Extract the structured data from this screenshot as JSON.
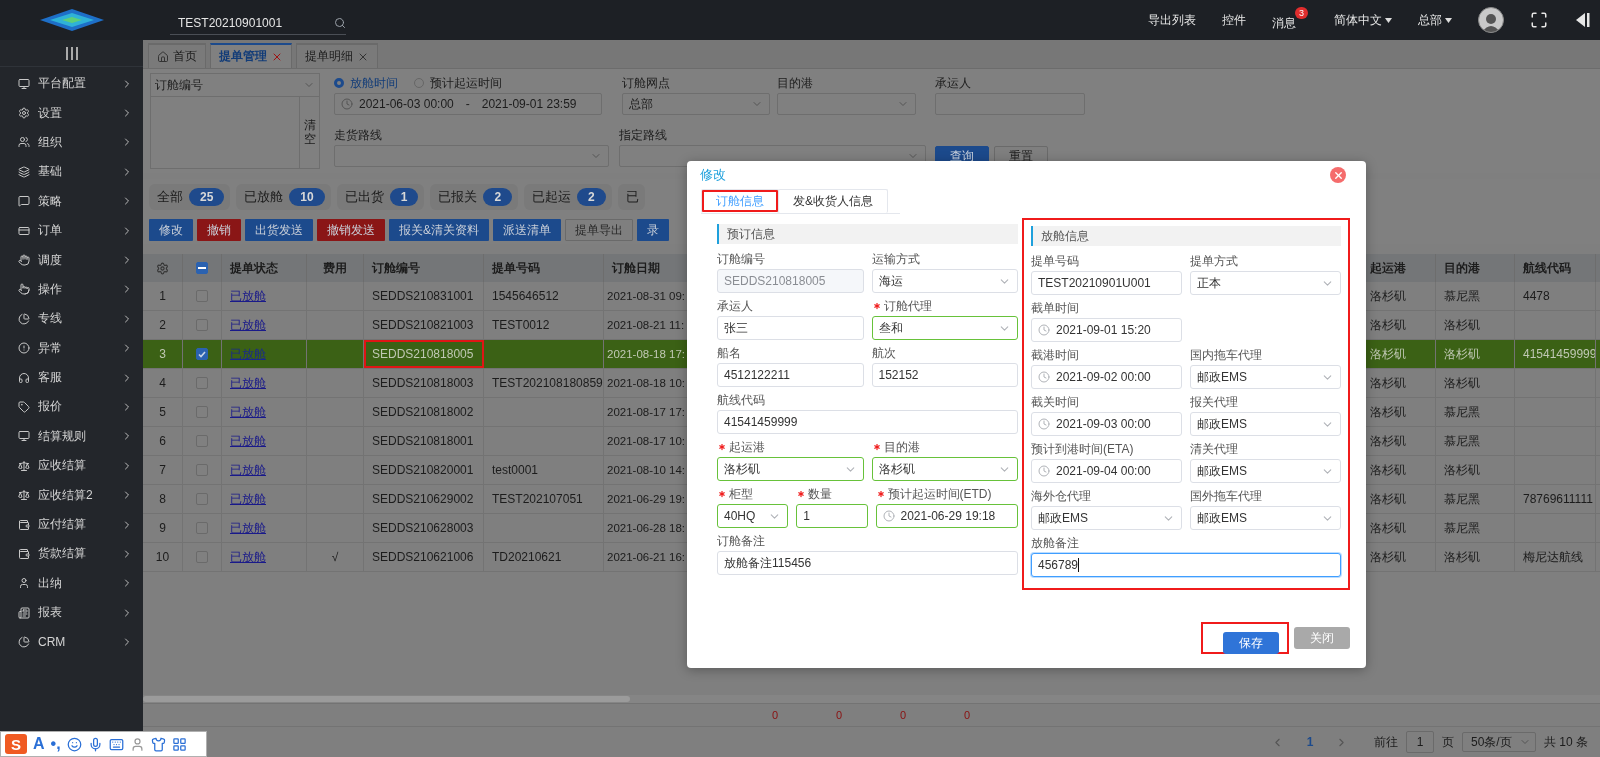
{
  "topbar": {
    "search": {
      "value": "TEST20210901001"
    },
    "links": [
      {
        "label": "导出列表",
        "dropdown": false
      },
      {
        "label": "控件",
        "dropdown": false
      },
      {
        "label": "消息",
        "dropdown": false,
        "badge": "3"
      },
      {
        "label": "简体中文",
        "dropdown": true
      },
      {
        "label": "总部",
        "dropdown": true
      }
    ]
  },
  "sidebar": {
    "items": [
      {
        "label": "平台配置"
      },
      {
        "label": "设置"
      },
      {
        "label": "组织"
      },
      {
        "label": "基础"
      },
      {
        "label": "策略"
      },
      {
        "label": "订单"
      },
      {
        "label": "调度"
      },
      {
        "label": "操作"
      },
      {
        "label": "专线"
      },
      {
        "label": "异常"
      },
      {
        "label": "客服"
      },
      {
        "label": "报价"
      },
      {
        "label": "结算规则"
      },
      {
        "label": "应收结算"
      },
      {
        "label": "应收结算2"
      },
      {
        "label": "应付结算"
      },
      {
        "label": "货款结算"
      },
      {
        "label": "出纳"
      },
      {
        "label": "报表"
      },
      {
        "label": "CRM"
      }
    ]
  },
  "page_tabs": [
    {
      "label": "首页",
      "kind": "home",
      "selected": false
    },
    {
      "label": "提单管理",
      "kind": "page",
      "selected": true
    },
    {
      "label": "提单明细",
      "kind": "page",
      "selected": false
    }
  ],
  "filters": {
    "field_select": "订舱编号",
    "clear_button": "清空",
    "time_options": [
      {
        "label": "放舱时间",
        "selected": true
      },
      {
        "label": "预计起运时间",
        "selected": false
      }
    ],
    "date_range": {
      "start": "2021-06-03 00:00",
      "separator": "-",
      "end": "2021-09-01 23:59"
    },
    "row1": [
      {
        "label": "订舱网点",
        "kind": "select",
        "value": "总部"
      },
      {
        "label": "目的港",
        "kind": "select"
      },
      {
        "label": "承运人",
        "kind": "input"
      }
    ],
    "row2": [
      {
        "label": "走货路线",
        "kind": "select"
      },
      {
        "label": "指定路线",
        "kind": "select"
      }
    ],
    "buttons": [
      {
        "label": "查询",
        "kind": "primary"
      },
      {
        "label": "重置",
        "kind": "default"
      }
    ]
  },
  "status_chips": [
    {
      "label": "全部",
      "count": "25"
    },
    {
      "label": "已放舱",
      "count": "10"
    },
    {
      "label": "已出货",
      "count": "1"
    },
    {
      "label": "已报关",
      "count": "2"
    },
    {
      "label": "已起运",
      "count": "2"
    },
    {
      "label": "已"
    }
  ],
  "actions": [
    {
      "label": "修改",
      "kind": "primary"
    },
    {
      "label": "撤销",
      "kind": "danger"
    },
    {
      "label": "出货发送",
      "kind": "primary"
    },
    {
      "label": "撤销发送",
      "kind": "danger"
    },
    {
      "label": "报关&清关资料",
      "kind": "primary"
    },
    {
      "label": "派送清单",
      "kind": "primary"
    },
    {
      "label": "提单导出",
      "kind": "default"
    },
    {
      "label": "录",
      "kind": "primary"
    }
  ],
  "table": {
    "select_all": {
      "partial": true
    },
    "columns": [
      "提单状态",
      "费用",
      "订舱编号",
      "提单号码",
      "订舱日期",
      "起运港",
      "目的港",
      "航线代码"
    ],
    "rows": [
      {
        "index": "1",
        "checked": false,
        "selected": false,
        "annotated": false,
        "status": "已放舱",
        "order_no": "SEDDS210831001",
        "bill_no": "1545646512",
        "order_date": "2021-08-31 09:",
        "origin": "洛杉矶",
        "destination": "慕尼黑",
        "route_code": "4478"
      },
      {
        "index": "2",
        "checked": false,
        "selected": false,
        "annotated": false,
        "status": "已放舱",
        "order_no": "SEDDS210821003",
        "bill_no": "TEST0012",
        "order_date": "2021-08-21 11:",
        "origin": "洛杉矶",
        "destination": "洛杉矶"
      },
      {
        "index": "3",
        "checked": true,
        "selected": true,
        "annotated": true,
        "status": "已放舱",
        "order_no": "SEDDS210818005",
        "order_date": "2021-08-18 17:",
        "origin": "洛杉矶",
        "destination": "洛杉矶",
        "route_code": "41541459999"
      },
      {
        "index": "4",
        "checked": false,
        "selected": false,
        "annotated": false,
        "status": "已放舱",
        "order_no": "SEDDS210818003",
        "bill_no": "TEST202108180859",
        "order_date": "2021-08-18 10:",
        "origin": "洛杉矶",
        "destination": "洛杉矶"
      },
      {
        "index": "5",
        "checked": false,
        "selected": false,
        "annotated": false,
        "status": "已放舱",
        "order_no": "SEDDS210818002",
        "order_date": "2021-08-17 17:",
        "origin": "洛杉矶",
        "destination": "慕尼黑"
      },
      {
        "index": "6",
        "checked": false,
        "selected": false,
        "annotated": false,
        "status": "已放舱",
        "order_no": "SEDDS210818001",
        "order_date": "2021-08-17 10:",
        "origin": "洛杉矶",
        "destination": "慕尼黑"
      },
      {
        "index": "7",
        "checked": false,
        "selected": false,
        "annotated": false,
        "status": "已放舱",
        "order_no": "SEDDS210820001",
        "bill_no": "test0001",
        "order_date": "2021-08-10 14:",
        "origin": "洛杉矶",
        "destination": "洛杉矶"
      },
      {
        "index": "8",
        "checked": false,
        "selected": false,
        "annotated": false,
        "status": "已放舱",
        "order_no": "SEDDS210629002",
        "bill_no": "TEST202107051",
        "order_date": "2021-06-29 19:",
        "origin": "洛杉矶",
        "destination": "慕尼黑",
        "route_code": "78769611111"
      },
      {
        "index": "9",
        "checked": false,
        "selected": false,
        "annotated": false,
        "status": "已放舱",
        "order_no": "SEDDS210628003",
        "order_date": "2021-06-28 18:",
        "origin": "洛杉矶",
        "destination": "慕尼黑"
      },
      {
        "index": "10",
        "checked": false,
        "selected": false,
        "annotated": false,
        "status": "已放舱",
        "fee": "√",
        "order_no": "SEDDS210621006",
        "bill_no": "TD20210621",
        "order_date": "2021-06-21 16:",
        "origin": "洛杉矶",
        "destination": "洛杉矶",
        "route_code": "梅尼达航线"
      }
    ],
    "totals": [
      "0",
      "0",
      "0",
      "0"
    ]
  },
  "pagination": {
    "pages": [
      {
        "label": "1",
        "selected": true
      }
    ],
    "goto_label": "前往",
    "goto_value": "1",
    "page_suffix": "页",
    "page_size": "50条/页",
    "total": "共 10 条"
  },
  "dialog": {
    "title": "修改",
    "tabs": [
      {
        "label": "订舱信息",
        "selected": true,
        "annotated": true
      },
      {
        "label": "发&收货人信息",
        "selected": false,
        "annotated": false
      }
    ],
    "sections": [
      {
        "title": "预订信息",
        "annotated": false,
        "rows": [
          [
            {
              "label": "订舱编号",
              "kind": "input",
              "value": "SEDDS210818005",
              "required": false,
              "disabled": true,
              "focused": false
            },
            {
              "label": "运输方式",
              "kind": "select",
              "value": "海运",
              "required": false,
              "disabled": false,
              "focused": false
            }
          ],
          [
            {
              "label": "承运人",
              "kind": "input",
              "value": "张三",
              "required": false,
              "disabled": false,
              "focused": false
            },
            {
              "label": "订舱代理",
              "kind": "select",
              "value": "叁和",
              "required": true,
              "disabled": false,
              "focused": false
            }
          ],
          [
            {
              "label": "船名",
              "kind": "input",
              "value": "4512122211",
              "required": false,
              "disabled": false,
              "focused": false
            },
            {
              "label": "航次",
              "kind": "input",
              "value": "152152",
              "required": false,
              "disabled": false,
              "focused": false
            }
          ],
          [
            {
              "label": "航线代码",
              "kind": "input",
              "value": "41541459999",
              "required": false,
              "disabled": false,
              "focused": false
            }
          ],
          [
            {
              "label": "起运港",
              "kind": "select",
              "value": "洛杉矶",
              "required": true,
              "disabled": false,
              "focused": false
            },
            {
              "label": "目的港",
              "kind": "select",
              "value": "洛杉矶",
              "required": true,
              "disabled": false,
              "focused": false
            }
          ],
          [
            {
              "label": "柜型",
              "kind": "select",
              "value": "40HQ",
              "required": true,
              "disabled": false,
              "focused": false
            },
            {
              "label": "数量",
              "kind": "input",
              "value": "1",
              "required": true,
              "disabled": false,
              "focused": false
            },
            {
              "label": "预计起运时间(ETD)",
              "kind": "date",
              "value": "2021-06-29 19:18",
              "required": true,
              "disabled": false,
              "focused": false
            }
          ],
          [
            {
              "label": "订舱备注",
              "kind": "input",
              "value": "放舱备注115456",
              "required": false,
              "disabled": false,
              "focused": false
            }
          ]
        ]
      },
      {
        "title": "放舱信息",
        "annotated": true,
        "rows": [
          [
            {
              "label": "提单号码",
              "kind": "input",
              "value": "TEST20210901U001",
              "required": false,
              "disabled": false,
              "focused": false
            },
            {
              "label": "提单方式",
              "kind": "select",
              "value": "正本",
              "required": false,
              "disabled": false,
              "focused": false
            }
          ],
          [
            {
              "label": "截单时间",
              "kind": "date",
              "value": "2021-09-01 15:20",
              "required": false,
              "disabled": false,
              "focused": false
            }
          ],
          [
            {
              "label": "截港时间",
              "kind": "date",
              "value": "2021-09-02 00:00",
              "required": false,
              "disabled": false,
              "focused": false
            },
            {
              "label": "国内拖车代理",
              "kind": "select",
              "value": "邮政EMS",
              "required": false,
              "disabled": false,
              "focused": false
            }
          ],
          [
            {
              "label": "截关时间",
              "kind": "date",
              "value": "2021-09-03 00:00",
              "required": false,
              "disabled": false,
              "focused": false
            },
            {
              "label": "报关代理",
              "kind": "select",
              "value": "邮政EMS",
              "required": false,
              "disabled": false,
              "focused": false
            }
          ],
          [
            {
              "label": "预计到港时间(ETA)",
              "kind": "date",
              "value": "2021-09-04 00:00",
              "required": false,
              "disabled": false,
              "focused": false
            },
            {
              "label": "清关代理",
              "kind": "select",
              "value": "邮政EMS",
              "required": false,
              "disabled": false,
              "focused": false
            }
          ],
          [
            {
              "label": "海外仓代理",
              "kind": "select",
              "value": "邮政EMS",
              "required": false,
              "disabled": false,
              "focused": false
            },
            {
              "label": "国外拖车代理",
              "kind": "select",
              "value": "邮政EMS",
              "required": false,
              "disabled": false,
              "focused": false
            }
          ],
          [
            {
              "label": "放舱备注",
              "kind": "input",
              "value": "456789",
              "required": false,
              "disabled": false,
              "focused": true
            }
          ]
        ]
      }
    ],
    "buttons": [
      {
        "label": "保存",
        "kind": "primary",
        "annotated": true
      },
      {
        "label": "关闭",
        "kind": "muted",
        "annotated": false
      }
    ]
  },
  "ime_toolbar": {
    "logo": "S",
    "glyphs": [
      "A",
      "•,"
    ]
  }
}
